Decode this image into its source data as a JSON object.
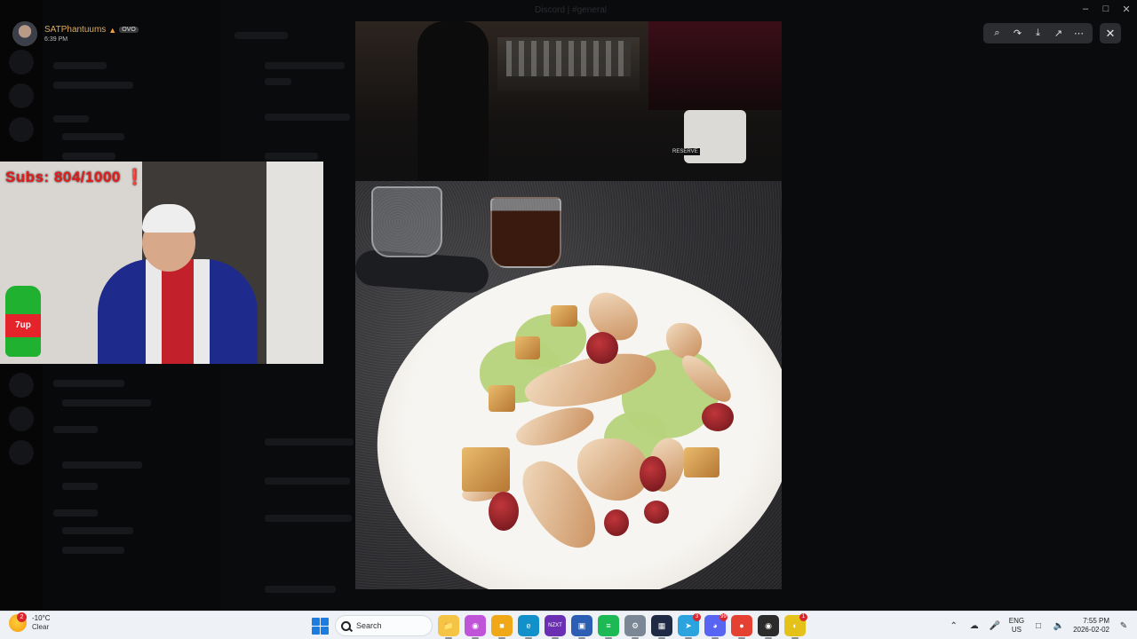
{
  "window": {
    "title": "Discord | #general"
  },
  "uploader": {
    "name": "SATPhantuums",
    "badge": "OVO",
    "time": "6:39 PM"
  },
  "overlay": {
    "subs_text": "Subs: 804/1000 ❗"
  },
  "viewer": {
    "tools": [
      {
        "name": "zoom-icon",
        "glyph": "⌕"
      },
      {
        "name": "forward-icon",
        "glyph": "↷"
      },
      {
        "name": "download-icon",
        "glyph": "⤓"
      },
      {
        "name": "open-external-icon",
        "glyph": "↗"
      },
      {
        "name": "more-icon",
        "glyph": "⋯"
      }
    ],
    "close_glyph": "✕",
    "photo_label": "RESERVE"
  },
  "taskbar": {
    "weather": {
      "temp": "-10°C",
      "condition": "Clear",
      "badge": "2"
    },
    "search_placeholder": "Search",
    "apps": [
      {
        "name": "file-explorer-icon",
        "glyph": "📁",
        "color": "#f6c444"
      },
      {
        "name": "copilot-icon",
        "glyph": "◉",
        "color": "#c054d9"
      },
      {
        "name": "folder-icon",
        "glyph": "■",
        "color": "#f0a818"
      },
      {
        "name": "edge-icon",
        "glyph": "e",
        "color": "#1190c9"
      },
      {
        "name": "nzxt-icon",
        "glyph": "NZXT",
        "color": "#6b2fb4"
      },
      {
        "name": "app-blue-icon",
        "glyph": "▣",
        "color": "#2c5fb3"
      },
      {
        "name": "spotify-icon",
        "glyph": "≡",
        "color": "#1db954"
      },
      {
        "name": "settings-icon",
        "glyph": "⚙",
        "color": "#7b8794"
      },
      {
        "name": "app-dark-icon",
        "glyph": "▦",
        "color": "#1f2a44"
      },
      {
        "name": "telegram-icon",
        "glyph": "➤",
        "color": "#2aa3de",
        "badge": "3"
      },
      {
        "name": "discord-icon",
        "glyph": "◕",
        "color": "#5865f2",
        "badge": "99"
      },
      {
        "name": "chrome-icon",
        "glyph": "●",
        "color": "#e44133"
      },
      {
        "name": "obs-icon",
        "glyph": "◉",
        "color": "#2b2b2b"
      },
      {
        "name": "app-yellow-icon",
        "glyph": "◐",
        "color": "#e5c21a",
        "badge": "1"
      }
    ],
    "tray": {
      "language": "ENG",
      "region": "US",
      "time": "7:55 PM",
      "date": "2026-02-02"
    }
  }
}
